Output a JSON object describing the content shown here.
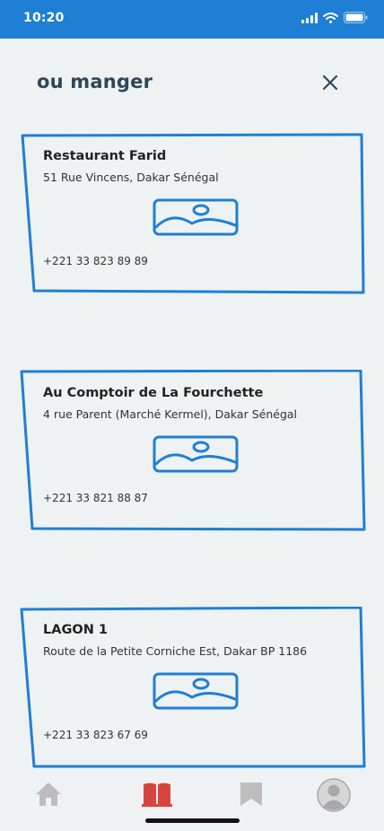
{
  "status_bar": {
    "time": "10:20"
  },
  "header": {
    "title": "ou manger",
    "close_icon": "close-icon"
  },
  "restaurants": [
    {
      "name": "Restaurant Farid",
      "address": "51 Rue Vincens, Dakar Sénégal",
      "phone": "+221 33 823 89 89",
      "image_icon": "image-placeholder-icon"
    },
    {
      "name": "Au Comptoir de La Fourchette",
      "address": "4 rue Parent (Marché Kermel), Dakar Sénégal",
      "phone": "+221 33 821 88 87",
      "image_icon": "image-placeholder-icon"
    },
    {
      "name": "LAGON 1",
      "address": "Route de la Petite Corniche Est, Dakar BP 1186",
      "phone": "+221 33 823 67 69",
      "image_icon": "image-placeholder-icon"
    }
  ],
  "tab_bar": {
    "tabs": [
      {
        "id": "home",
        "icon": "home-icon",
        "active": false
      },
      {
        "id": "book",
        "icon": "book-icon",
        "active": true
      },
      {
        "id": "bookmark",
        "icon": "bookmark-icon",
        "active": false
      },
      {
        "id": "profile",
        "icon": "profile-icon",
        "active": false
      }
    ]
  },
  "colors": {
    "accent": "#1f7fd4",
    "active_tab": "#d9443f",
    "inactive_tab": "#bdbdbd",
    "background": "#eef2f3"
  }
}
